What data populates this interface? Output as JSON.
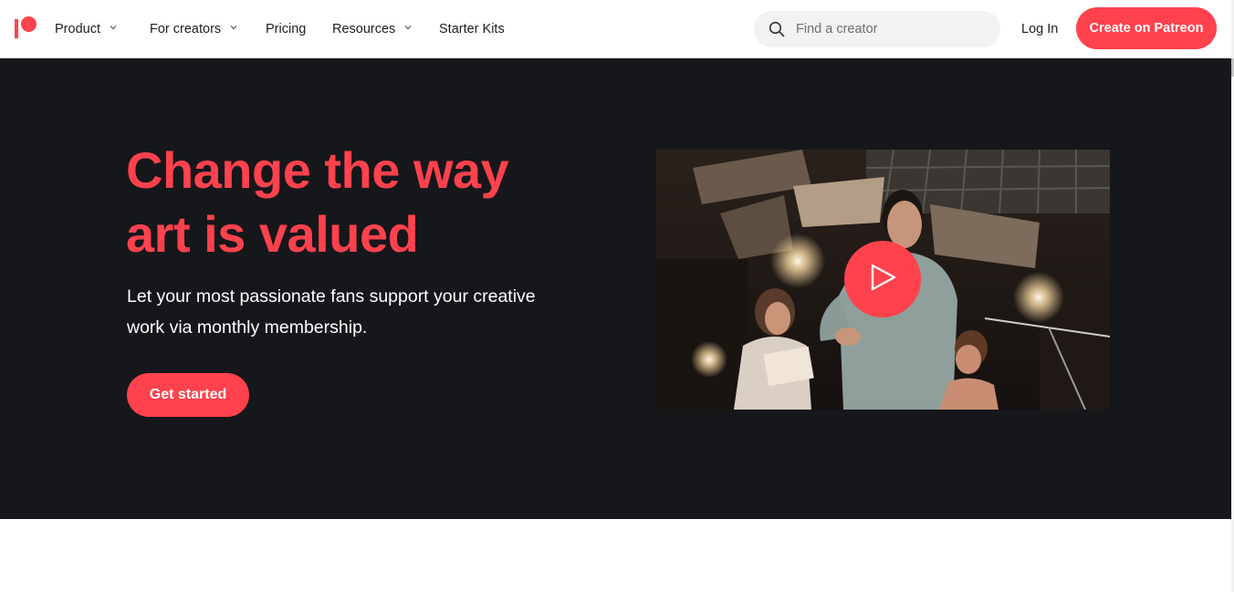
{
  "brand": {
    "logo_alt": "Patreon",
    "accent_color": "#ff424d",
    "hero_bg_color": "#16171b"
  },
  "nav": {
    "items": [
      {
        "label": "Product",
        "has_dropdown": true
      },
      {
        "label": "For creators",
        "has_dropdown": true
      },
      {
        "label": "Pricing",
        "has_dropdown": false
      },
      {
        "label": "Resources",
        "has_dropdown": true
      },
      {
        "label": "Starter Kits",
        "has_dropdown": false
      }
    ]
  },
  "search": {
    "placeholder": "Find a creator",
    "icon": "search-icon"
  },
  "header": {
    "login_label": "Log In",
    "cta_label": "Create on Patreon"
  },
  "hero": {
    "headline_line1": "Change the way",
    "headline_line2": "art is valued",
    "subtext_line1": "Let your most passionate fans support your creative",
    "subtext_line2": "work via monthly membership.",
    "button_label": "Get started"
  },
  "video": {
    "play_icon": "play-icon"
  }
}
